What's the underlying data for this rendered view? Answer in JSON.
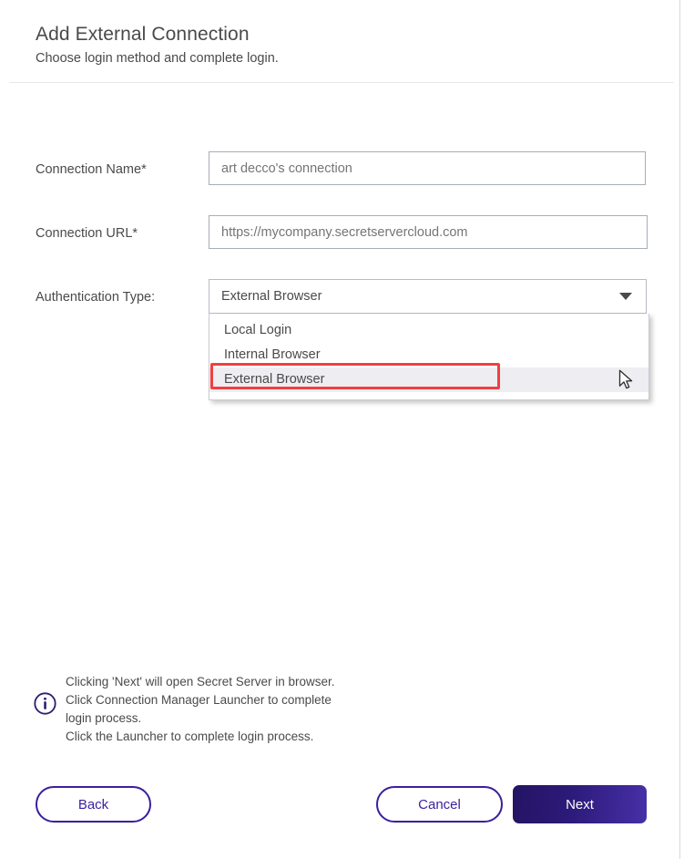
{
  "header": {
    "title": "Add External Connection",
    "subtitle": "Choose login method and complete login."
  },
  "form": {
    "connection_name": {
      "label": "Connection Name*",
      "value": "",
      "placeholder": "art decco's connection"
    },
    "connection_url": {
      "label": "Connection URL*",
      "value": "",
      "placeholder": "https://mycompany.secretservercloud.com"
    },
    "authentication_type": {
      "label": "Authentication Type:",
      "selected": "External Browser",
      "options": [
        "Local Login",
        "Internal Browser",
        "External Browser"
      ],
      "expanded": true,
      "highlighted_option": "External Browser"
    }
  },
  "info": {
    "icon": "info-circle-icon",
    "lines": [
      "Clicking 'Next' will open Secret Server in browser.",
      "Click Connection Manager Launcher to complete",
      "login process.",
      "Click the Launcher to complete login process."
    ]
  },
  "footer": {
    "back_label": "Back",
    "cancel_label": "Cancel",
    "next_label": "Next"
  },
  "annotation": {
    "color": "#f04040",
    "target": "External Browser"
  },
  "colors": {
    "brand_purple": "#3b1f9e",
    "primary_button_start": "#241464",
    "primary_button_end": "#4630a8",
    "text": "#4a4a4a",
    "placeholder": "#8d8d92",
    "input_border": "#a6aeb8",
    "divider": "#e8e8ec",
    "option_highlight": "#ededf2"
  }
}
